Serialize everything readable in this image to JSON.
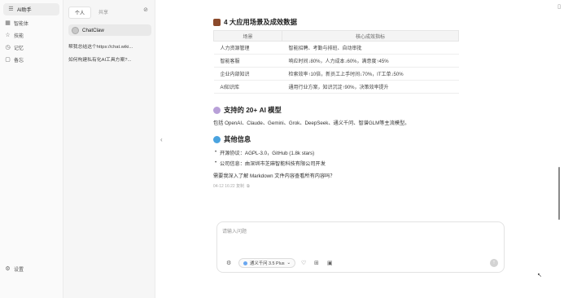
{
  "nav": {
    "items": [
      {
        "icon": "chat-bubble-icon",
        "glyph": "☰",
        "label": "AI助手",
        "active": true
      },
      {
        "icon": "grid-icon",
        "glyph": "▦",
        "label": "智能体",
        "active": false
      },
      {
        "icon": "star-icon",
        "glyph": "☆",
        "label": "技能",
        "active": false
      },
      {
        "icon": "clock-icon",
        "glyph": "◷",
        "label": "记忆",
        "active": false
      },
      {
        "icon": "note-icon",
        "glyph": "▢",
        "label": "备忘",
        "active": false
      }
    ],
    "settings": {
      "icon": "gear-icon",
      "glyph": "⚙",
      "label": "设置"
    }
  },
  "panel": {
    "tabs": [
      "个人",
      "共享"
    ],
    "agent_name": "ChatClaw",
    "sessions": [
      "帮我总结这个https://chat.wiki...",
      "如何构建私有化AI工具方案?..."
    ]
  },
  "content": {
    "section1_title": "4 大应用场景及成效数据",
    "table": {
      "headers": [
        "场景",
        "核心成效指标"
      ],
      "rows": [
        [
          "人力资源管理",
          "智能招聘、考勤与排班、自动审批"
        ],
        [
          "智能客服",
          "响应时间↓80%，人力成本↓60%，满意度↑45%"
        ],
        [
          "企业内部知识",
          "检索效率↑10倍，新员工上手时间↓70%，IT工单↓50%"
        ],
        [
          "AI知识库",
          "通用行业方案，知识沉淀↑90%，决策效率提升"
        ]
      ]
    },
    "section2_title": "支持的 20+ AI 模型",
    "section2_text": "包括 OpenAI、Claude、Gemini、Grok、DeepSeek、通义千问、智谱GLM等主流模型。",
    "section3_title": "其他信息",
    "bullets": [
      "开源协议：AGPL-3.0，GitHub (1.8k stars)",
      "公司信息：由深圳市芝麻智能科技有限公司开发"
    ],
    "footer_text": "需要我深入了解 Markdown 文件内容查看所有内容吗？",
    "meta": "04-12 16:22  复制"
  },
  "composer": {
    "placeholder": "请输入问题",
    "model": "通义千问 3.5 Plus"
  },
  "colors": {
    "accent": "#6aa7f0",
    "section_icon": "#a0522d"
  }
}
